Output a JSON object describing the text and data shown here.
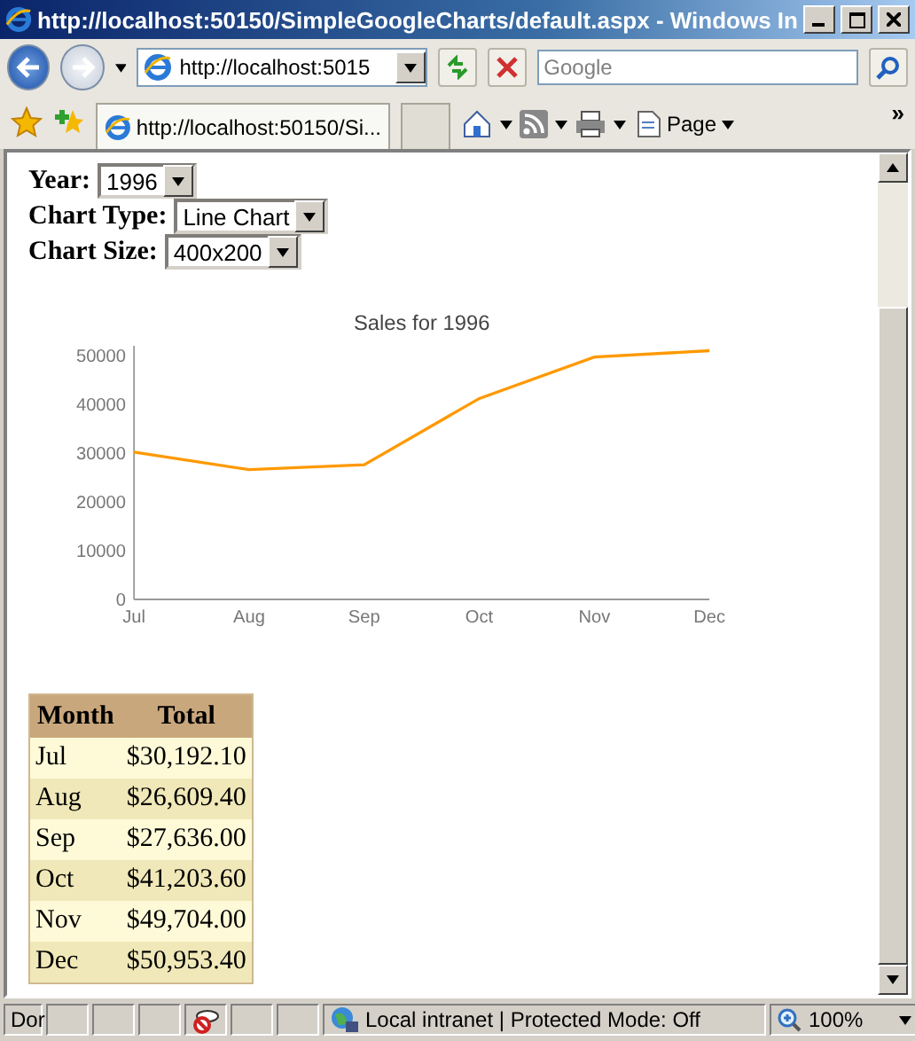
{
  "window": {
    "title": "http://localhost:50150/SimpleGoogleCharts/default.aspx - Windows In"
  },
  "toolbar": {
    "address": "http://localhost:5015",
    "search": {
      "placeholder": "Google"
    }
  },
  "tabs": [
    {
      "label": "http://localhost:50150/Si...",
      "selected": true
    }
  ],
  "command_bar": {
    "page_label": "Page",
    "more": "»"
  },
  "form": [
    {
      "label": "Year:",
      "value": "1996"
    },
    {
      "label": "Chart Type:",
      "value": "Line Chart"
    },
    {
      "label": "Chart Size:",
      "value": "400x200"
    }
  ],
  "chart": {
    "chart_data": {
      "type": "line",
      "title": "Sales for 1996",
      "categories": [
        "Jul",
        "Aug",
        "Sep",
        "Oct",
        "Nov",
        "Dec"
      ],
      "series": [
        {
          "color": "#ff9900",
          "values": [
            30200,
            26600,
            27600,
            41200,
            49700,
            51000
          ]
        }
      ],
      "ylim": [
        0,
        52000
      ],
      "yticks": [
        0,
        10000,
        20000,
        30000,
        40000,
        50000
      ]
    }
  },
  "table": {
    "columns": [
      "Month",
      "Total"
    ],
    "rows": [
      [
        "Jul",
        "$30,192.10"
      ],
      [
        "Aug",
        "$26,609.40"
      ],
      [
        "Sep",
        "$27,636.00"
      ],
      [
        "Oct",
        "$41,203.60"
      ],
      [
        "Nov",
        "$49,704.00"
      ],
      [
        "Dec",
        "$50,953.40"
      ]
    ]
  },
  "status_bar": {
    "status": "Dor",
    "zone": "Local intranet | Protected Mode: Off",
    "zoom": "100%"
  }
}
